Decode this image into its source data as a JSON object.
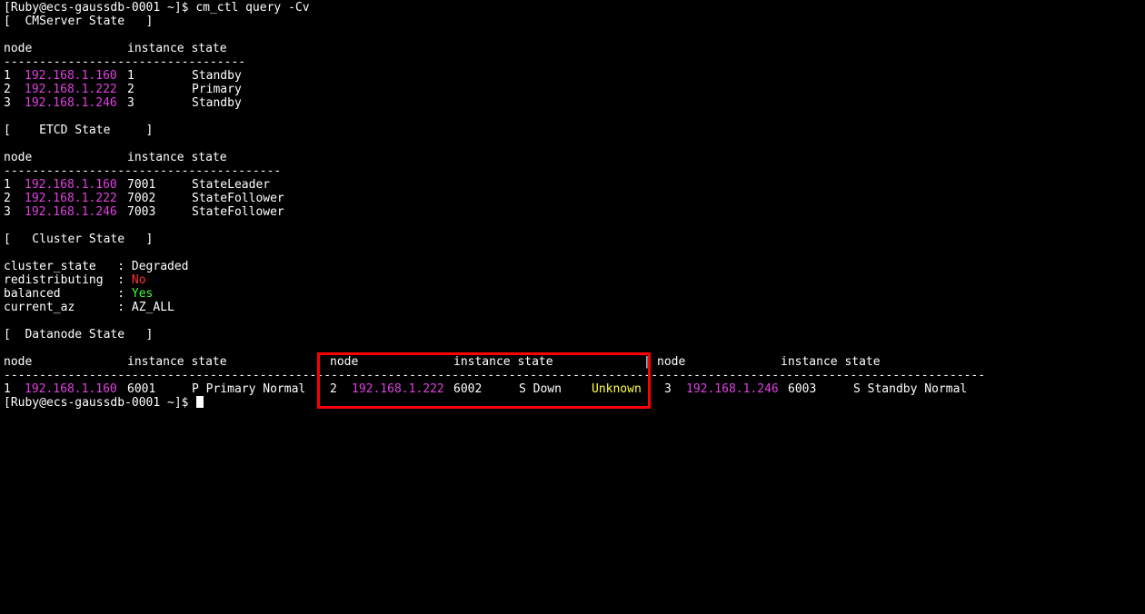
{
  "prompt": "[Ruby@ecs-gaussdb-0001 ~]$ cm_ctl query -Cv",
  "cmserver": {
    "heading": "[  CMServer State   ]",
    "col_node": "node",
    "col_instance": "instance state",
    "rule": "----------------------------------",
    "rows": [
      {
        "num": "1",
        "ip": "192.168.1.160",
        "inst": "1",
        "state": "Standby"
      },
      {
        "num": "2",
        "ip": "192.168.1.222",
        "inst": "2",
        "state": "Primary"
      },
      {
        "num": "3",
        "ip": "192.168.1.246",
        "inst": "3",
        "state": "Standby"
      }
    ]
  },
  "etcd": {
    "heading": "[    ETCD State     ]",
    "col_node": "node",
    "col_instance": "instance state",
    "rule": "---------------------------------------",
    "rows": [
      {
        "num": "1",
        "ip": "192.168.1.160",
        "inst": "7001",
        "state": "StateLeader"
      },
      {
        "num": "2",
        "ip": "192.168.1.222",
        "inst": "7002",
        "state": "StateFollower"
      },
      {
        "num": "3",
        "ip": "192.168.1.246",
        "inst": "7003",
        "state": "StateFollower"
      }
    ]
  },
  "cluster": {
    "heading": "[   Cluster State   ]",
    "state_key": "cluster_state   : ",
    "state_val": "Degraded",
    "redist_key": "redistributing  : ",
    "redist_val": "No",
    "balanced_key": "balanced        : ",
    "balanced_val": "Yes",
    "az_key": "current_az      : ",
    "az_val": "AZ_ALL"
  },
  "datanode": {
    "heading": "[  Datanode State   ]",
    "col_node": "node",
    "col_instance": "instance state",
    "separator": "|",
    "rule": "------------------------------------------------------------------------------------------------------------------------------------------",
    "rows": [
      {
        "num": "1",
        "ip": "192.168.1.160",
        "inst": "6001",
        "state": "P Primary Normal"
      },
      {
        "num": "2",
        "ip": "192.168.1.222",
        "inst": "6002",
        "state": "S Down",
        "extra": "Unknown"
      },
      {
        "num": "3",
        "ip": "192.168.1.246",
        "inst": "6003",
        "state": "S Standby Normal"
      }
    ]
  },
  "final_prompt": "[Ruby@ecs-gaussdb-0001 ~]$ ",
  "colors": {
    "background": "#000000",
    "text": "#ffffff",
    "ip": "#e040e0",
    "no": "#ff3030",
    "yes": "#40ff40",
    "unknown": "#ffff40",
    "highlight_box": "#ff0000"
  }
}
